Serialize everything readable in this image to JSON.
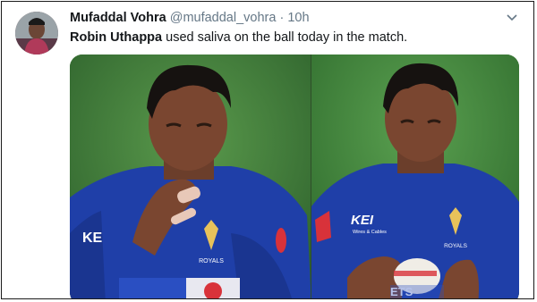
{
  "tweet": {
    "author_name": "Mufaddal Vohra",
    "handle": "@mufaddal_vohra",
    "separator": "·",
    "time": "10h",
    "text_bold": "Robin Uthappa",
    "text_rest": " used saliva on the ball today in the match."
  },
  "media": {
    "left_jersey": {
      "sponsor": "KE",
      "logo_text": "ROYALS"
    },
    "right_jersey": {
      "sponsor": "KEI",
      "sponsor_sub": "Wires & Cables",
      "logo_text": "ROYALS",
      "chest_text": "ETS"
    }
  },
  "icons": {
    "menu": "chevron-down-icon"
  },
  "colors": {
    "name": "#14171a",
    "secondary": "#657786",
    "jersey": "#1f3fa8",
    "pitch": "#3d7a3a"
  }
}
